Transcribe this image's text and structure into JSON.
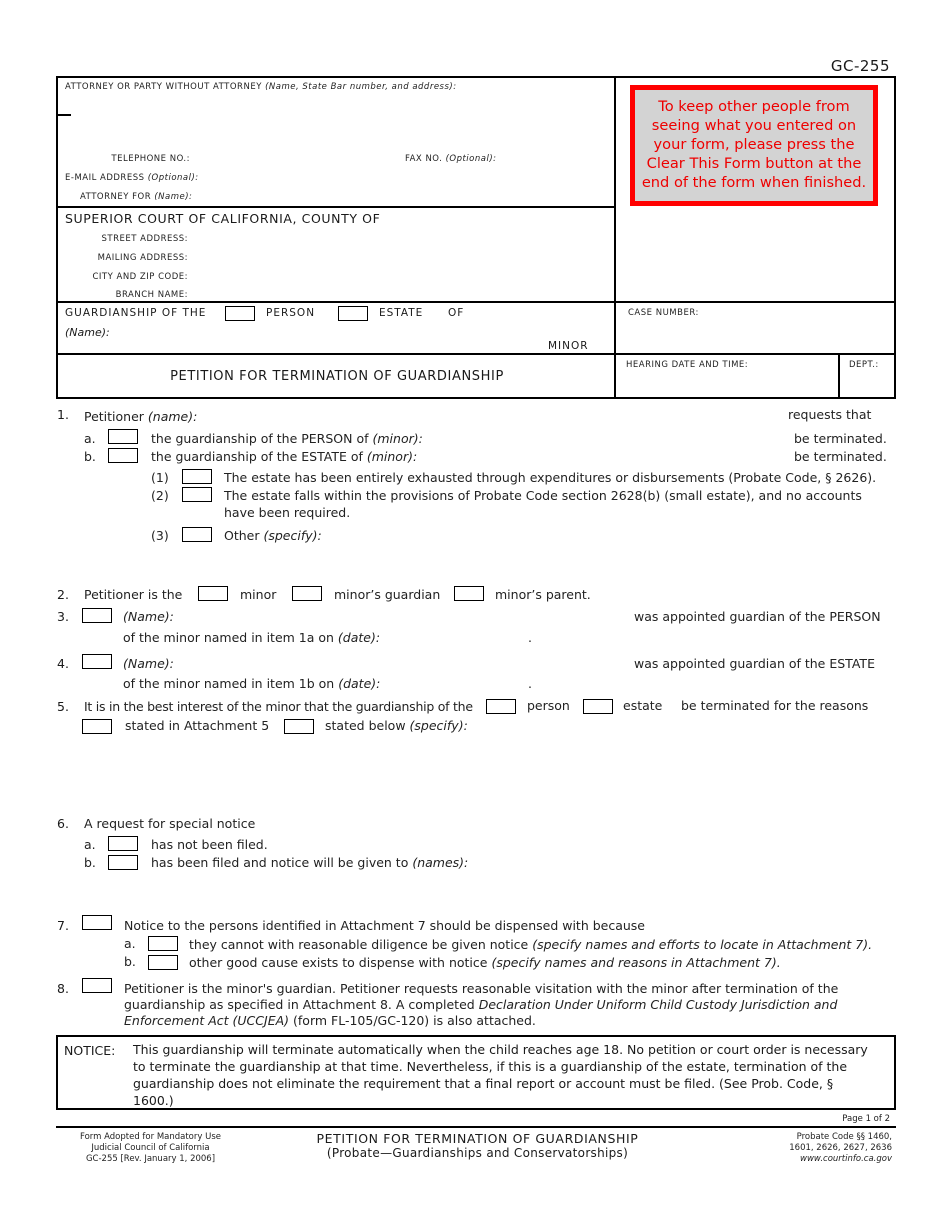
{
  "form_code": "GC-255",
  "header": {
    "attorney_label": "ATTORNEY OR PARTY WITHOUT ATTORNEY",
    "attorney_hint": "(Name, State Bar number, and address):",
    "telephone_label": "TELEPHONE NO.:",
    "fax_label": "FAX NO.",
    "fax_hint": "(Optional):",
    "email_label": "E-MAIL ADDRESS",
    "email_hint": "(Optional):",
    "attorney_for_label": "ATTORNEY FOR",
    "attorney_for_hint": "(Name):",
    "clear_notice": "To keep other people from seeing what you entered on your form, please press the Clear This Form button at the end of the form when finished.",
    "court_title": "SUPERIOR COURT OF CALIFORNIA, COUNTY OF",
    "street_label": "STREET ADDRESS:",
    "mailing_label": "MAILING ADDRESS:",
    "city_label": "CITY AND ZIP CODE:",
    "branch_label": "BRANCH NAME:",
    "guardianship_of_the": "GUARDIANSHIP OF THE",
    "person_label": "PERSON",
    "estate_label": "ESTATE",
    "of_label": "OF",
    "name_hint": "(Name):",
    "minor_label": "MINOR",
    "case_number_label": "CASE NUMBER:",
    "form_title": "PETITION FOR TERMINATION OF GUARDIANSHIP",
    "hearing_label": "HEARING DATE AND TIME:",
    "dept_label": "DEPT.:"
  },
  "items": {
    "i1": {
      "num": "1.",
      "petitioner": "Petitioner",
      "petitioner_hint": "(name):",
      "requests_that": "requests that",
      "a_letter": "a.",
      "a_text": "the guardianship of the PERSON of",
      "a_hint": "(minor):",
      "a_end": "be terminated.",
      "b_letter": "b.",
      "b_text": "the guardianship of the ESTATE of",
      "b_hint": "(minor):",
      "b_end": "be terminated.",
      "sub1_num": "(1)",
      "sub1_text": "The estate has been entirely exhausted through expenditures or disbursements (Probate Code, § 2626).",
      "sub2_num": "(2)",
      "sub2_text_line1": "The estate falls within the provisions of Probate Code section 2628(b) (small estate), and no accounts",
      "sub2_text_line2": "have been required.",
      "sub3_num": "(3)",
      "sub3_text": "Other",
      "sub3_hint": "(specify):"
    },
    "i2": {
      "num": "2.",
      "text": "Petitioner is the",
      "opt_minor": "minor",
      "opt_guardian": "minor’s guardian",
      "opt_parent": "minor’s parent."
    },
    "i3": {
      "num": "3.",
      "name_hint": "(Name):",
      "appointed": "was appointed guardian of the PERSON",
      "line2": "of the minor named in item 1a on",
      "date_hint": "(date):",
      "period": "."
    },
    "i4": {
      "num": "4.",
      "name_hint": "(Name):",
      "appointed": "was appointed guardian of the ESTATE",
      "line2": "of the minor named in item 1b on",
      "date_hint": "(date):",
      "period": "."
    },
    "i5": {
      "num": "5.",
      "text": "It is in the best interest of the minor that the guardianship of the",
      "opt_person": "person",
      "opt_estate": "estate",
      "text_end": "be terminated for the reasons",
      "opt_attachment": "stated in Attachment 5",
      "opt_below": "stated below",
      "opt_below_hint": "(specify):"
    },
    "i6": {
      "num": "6.",
      "text": "A request for special notice",
      "a_letter": "a.",
      "a_text": "has not been filed.",
      "b_letter": "b.",
      "b_text": "has been filed and notice will be given to",
      "b_hint": "(names):"
    },
    "i7": {
      "num": "7.",
      "text": "Notice to the persons identified in Attachment 7 should be dispensed with because",
      "a_letter": "a.",
      "a_text": "they cannot with reasonable diligence be given notice",
      "a_hint": "(specify names and efforts to locate in Attachment 7).",
      "b_letter": "b.",
      "b_text": "other good cause exists to dispense with notice",
      "b_hint": "(specify names and reasons in Attachment 7)."
    },
    "i8": {
      "num": "8.",
      "line1": "Petitioner is the minor's guardian.  Petitioner requests reasonable visitation with the minor after termination of the",
      "line2_a": "guardianship as specified in Attachment 8.  A completed",
      "line2_b": "Declaration Under Uniform Child Custody Jurisdiction and",
      "line3_a": "Enforcement Act (UCCJEA)",
      "line3_b": "(form FL-105/GC-120) is also attached."
    }
  },
  "notice": {
    "label": "NOTICE:",
    "text": "This guardianship will terminate automatically when the child reaches age 18.  No petition or court order is necessary to terminate the guardianship at that time.  Nevertheless, if this is a guardianship of the estate, termination of the guardianship does not eliminate the requirement that a final report or account must be filed. (See Prob. Code, § 1600.)"
  },
  "footer": {
    "page": "Page 1 of 2",
    "adopted_line1": "Form Adopted for Mandatory Use",
    "adopted_line2": "Judicial Council of California",
    "adopted_line3": "GC-255 [Rev. January 1, 2006]",
    "title": "PETITION FOR TERMINATION OF GUARDIANSHIP",
    "subtitle": "(Probate—Guardianships and Conservatorships)",
    "code_line1": "Probate Code §§ 1460,",
    "code_line2": "1601, 2626, 2627, 2636",
    "website": "www.courtinfo.ca.gov"
  }
}
